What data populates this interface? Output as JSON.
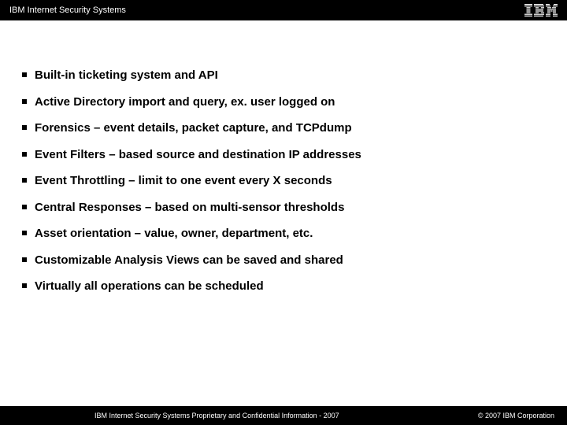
{
  "header": {
    "title": "IBM Internet Security Systems",
    "logo_text": "IBM"
  },
  "bullets": [
    "Built-in ticketing system and API",
    "Active Directory import and query, ex. user logged on",
    "Forensics – event details, packet capture, and TCPdump",
    "Event Filters – based source and destination IP addresses",
    "Event Throttling – limit to one event every X seconds",
    "Central Responses – based on multi-sensor thresholds",
    "Asset orientation – value, owner, department, etc.",
    "Customizable Analysis Views can be saved and shared",
    "Virtually all operations can be scheduled"
  ],
  "footer": {
    "left": "IBM Internet Security Systems Proprietary and Confidential Information - 2007",
    "right": "© 2007 IBM Corporation"
  }
}
